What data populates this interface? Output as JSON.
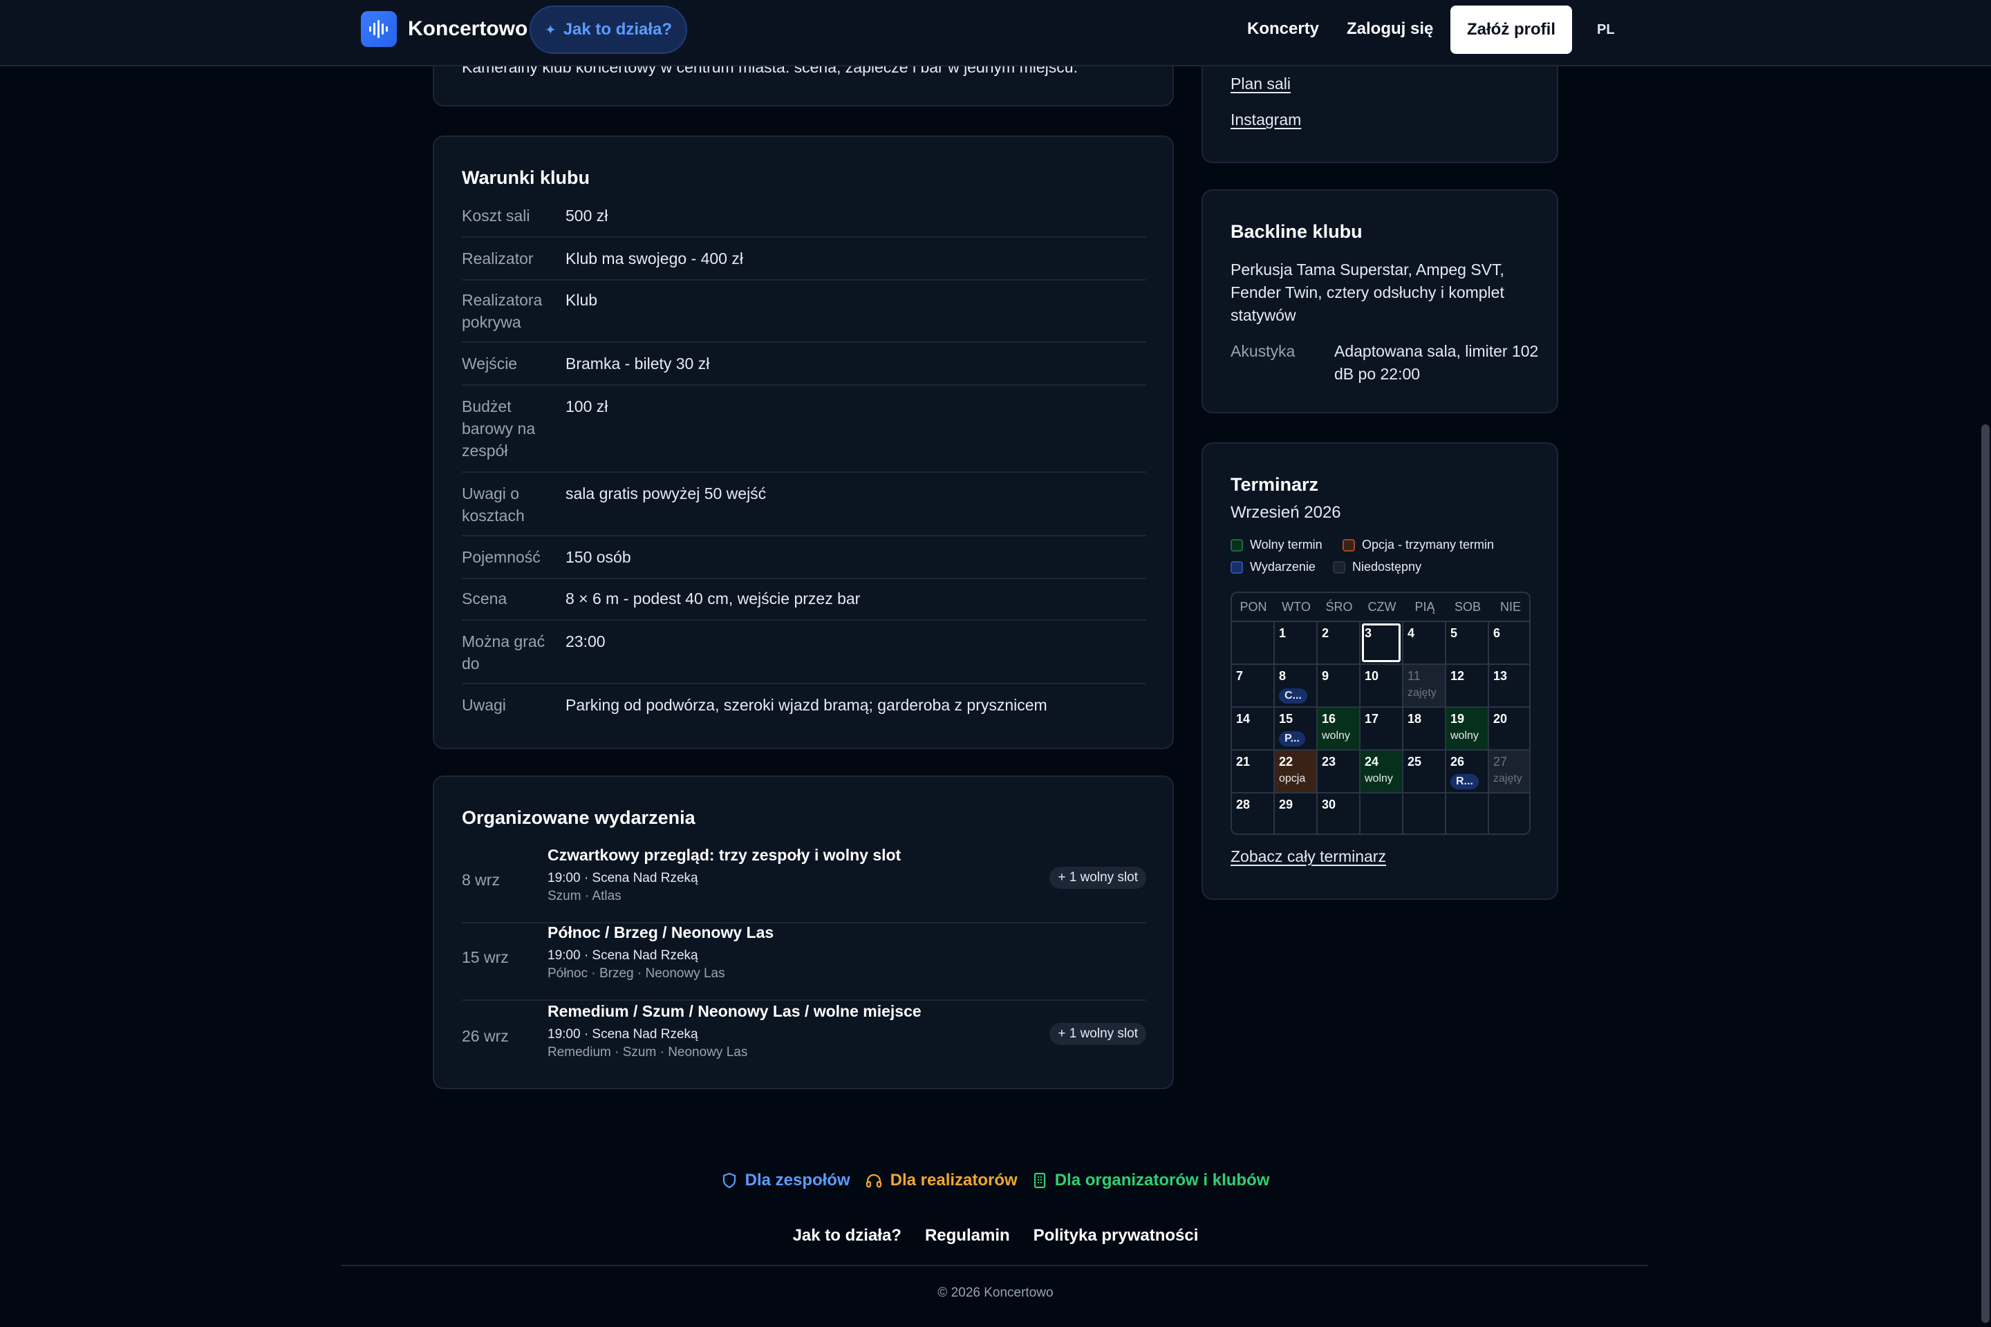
{
  "header": {
    "brand": "Koncertowo",
    "how_it_works": "Jak to działa?",
    "nav_concerts": "Koncerty",
    "nav_login": "Zaloguj się",
    "signup": "Załóż profil",
    "lang": "PL"
  },
  "about": {
    "text": "Kameralny klub koncertowy w centrum miasta: scena, zaplecze i bar w jednym miejscu."
  },
  "links": {
    "plan": "Plan sali",
    "instagram": "Instagram"
  },
  "terms": {
    "title": "Warunki klubu",
    "rows": [
      {
        "label": "Koszt sali",
        "value": "500 zł"
      },
      {
        "label": "Realizator",
        "value": "Klub ma swojego - 400 zł"
      },
      {
        "label": "Realizatora pokrywa",
        "value": "Klub"
      },
      {
        "label": "Wejście",
        "value": "Bramka - bilety 30 zł"
      },
      {
        "label": "Budżet barowy na zespół",
        "value": "100 zł"
      },
      {
        "label": "Uwagi o kosztach",
        "value": "sala gratis powyżej 50 wejść"
      },
      {
        "label": "Pojemność",
        "value": "150 osób"
      },
      {
        "label": "Scena",
        "value": "8 × 6 m - podest 40 cm, wejście przez bar"
      },
      {
        "label": "Można grać do",
        "value": "23:00"
      },
      {
        "label": "Uwagi",
        "value": "Parking od podwórza, szeroki wjazd bramą; garderoba z prysznicem"
      }
    ]
  },
  "events": {
    "title": "Organizowane wydarzenia",
    "items": [
      {
        "date": "8 wrz",
        "name": "Czwartkowy przegląd: trzy zespoły i wolny slot",
        "meta": "19:00 · Scena Nad Rzeką",
        "bands": "Szum · Atlas",
        "badge": "+ 1 wolny slot"
      },
      {
        "date": "15 wrz",
        "name": "Północ / Brzeg / Neonowy Las",
        "meta": "19:00 · Scena Nad Rzeką",
        "bands": "Północ · Brzeg · Neonowy Las",
        "badge": ""
      },
      {
        "date": "26 wrz",
        "name": "Remedium / Szum / Neonowy Las / wolne miejsce",
        "meta": "19:00 · Scena Nad Rzeką",
        "bands": "Remedium · Szum · Neonowy Las",
        "badge": "+ 1 wolny slot"
      }
    ]
  },
  "backline": {
    "title": "Backline klubu",
    "text": "Perkusja Tama Superstar, Ampeg SVT, Fender Twin, cztery odsłuchy i komplet statywów",
    "acoustic_label": "Akustyka",
    "acoustic_value": "Adaptowana sala, limiter 102 dB po 22:00"
  },
  "calendar": {
    "title": "Terminarz",
    "month": "Wrzesień 2026",
    "legend": {
      "free": "Wolny termin",
      "option": "Opcja - trzymany termin",
      "event": "Wydarzenie",
      "unavailable": "Niedostępny"
    },
    "weekdays": [
      "PON",
      "WTO",
      "ŚRO",
      "CZW",
      "PIĄ",
      "SOB",
      "NIE"
    ],
    "days": {
      "d1": "1",
      "d2": "2",
      "d3": "3",
      "d4": "4",
      "d5": "5",
      "d6": "6",
      "d7": "7",
      "d8": "8",
      "d9": "9",
      "d10": "10",
      "d11": "11",
      "d12": "12",
      "d13": "13",
      "d14": "14",
      "d15": "15",
      "d16": "16",
      "d17": "17",
      "d18": "18",
      "d19": "19",
      "d20": "20",
      "d21": "21",
      "d22": "22",
      "d23": "23",
      "d24": "24",
      "d25": "25",
      "d26": "26",
      "d27": "27",
      "d28": "28",
      "d29": "29",
      "d30": "30"
    },
    "tags": {
      "busy": "zajęty",
      "free": "wolny",
      "option": "opcja",
      "evt8": "C...",
      "evt15": "P...",
      "evt26": "R..."
    },
    "see_all": "Zobacz cały terminarz",
    "colors": {
      "free": "#06301c",
      "option": "#3a2316",
      "event": "#172f6b",
      "unavailable": "#1a2230"
    }
  },
  "footer": {
    "role_bands": "Dla zespołów",
    "role_realizers": "Dla realizatorów",
    "role_orgs": "Dla organizatorów i klubów",
    "how": "Jak to działa?",
    "terms": "Regulamin",
    "privacy": "Polityka prywatności",
    "copyright": "© 2026 Koncertowo"
  }
}
